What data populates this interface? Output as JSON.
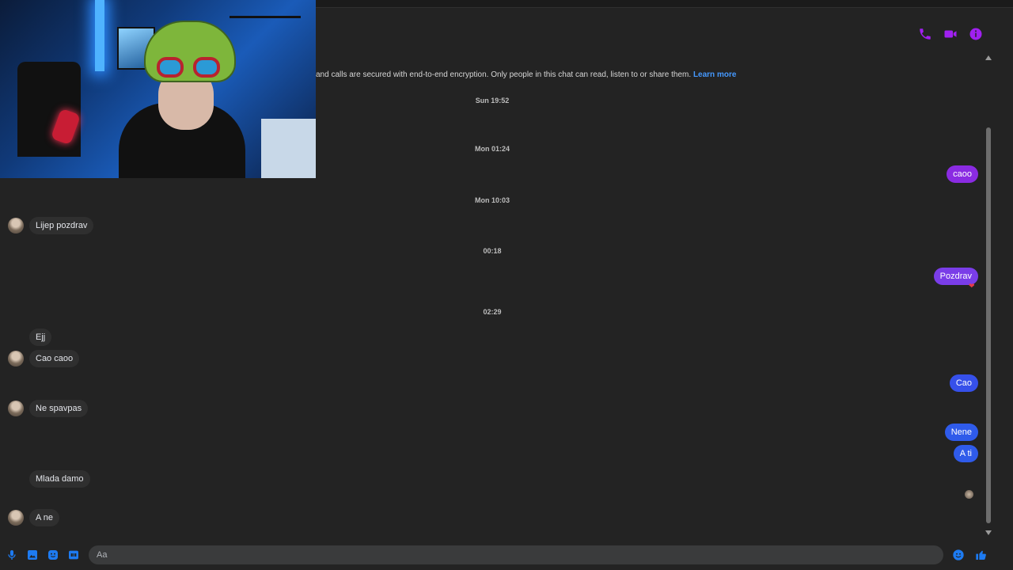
{
  "header": {
    "icons": [
      "phone-icon",
      "video-icon",
      "info-icon"
    ],
    "accent_color": "#a020f0"
  },
  "chat": {
    "encryption_notice": "and calls are secured with end-to-end encryption. Only people in this chat can read, listen to or share them.",
    "learn_more": "Learn more",
    "timestamps": [
      "Sun 19:52",
      "Mon 01:24",
      "Mon 10:03",
      "00:18",
      "02:29"
    ],
    "incoming": [
      "Lijep pozdrav",
      "Ejj",
      "Cao caoo",
      "Ne spavpas",
      "Mlada damo",
      "A ne"
    ],
    "outgoing": [
      "caoo",
      "Pozdrav",
      "Cao",
      "Nene",
      "A ti"
    ],
    "reaction": "❤",
    "colors": {
      "outgoing_purple": "#8a2be2",
      "outgoing_blue": "#2f5bea",
      "incoming": "#2f2f2f"
    }
  },
  "composer": {
    "placeholder": "Aa",
    "icons": [
      "microphone-icon",
      "image-icon",
      "sticker-icon",
      "gif-icon",
      "emoji-icon",
      "thumbs-up-icon"
    ]
  }
}
